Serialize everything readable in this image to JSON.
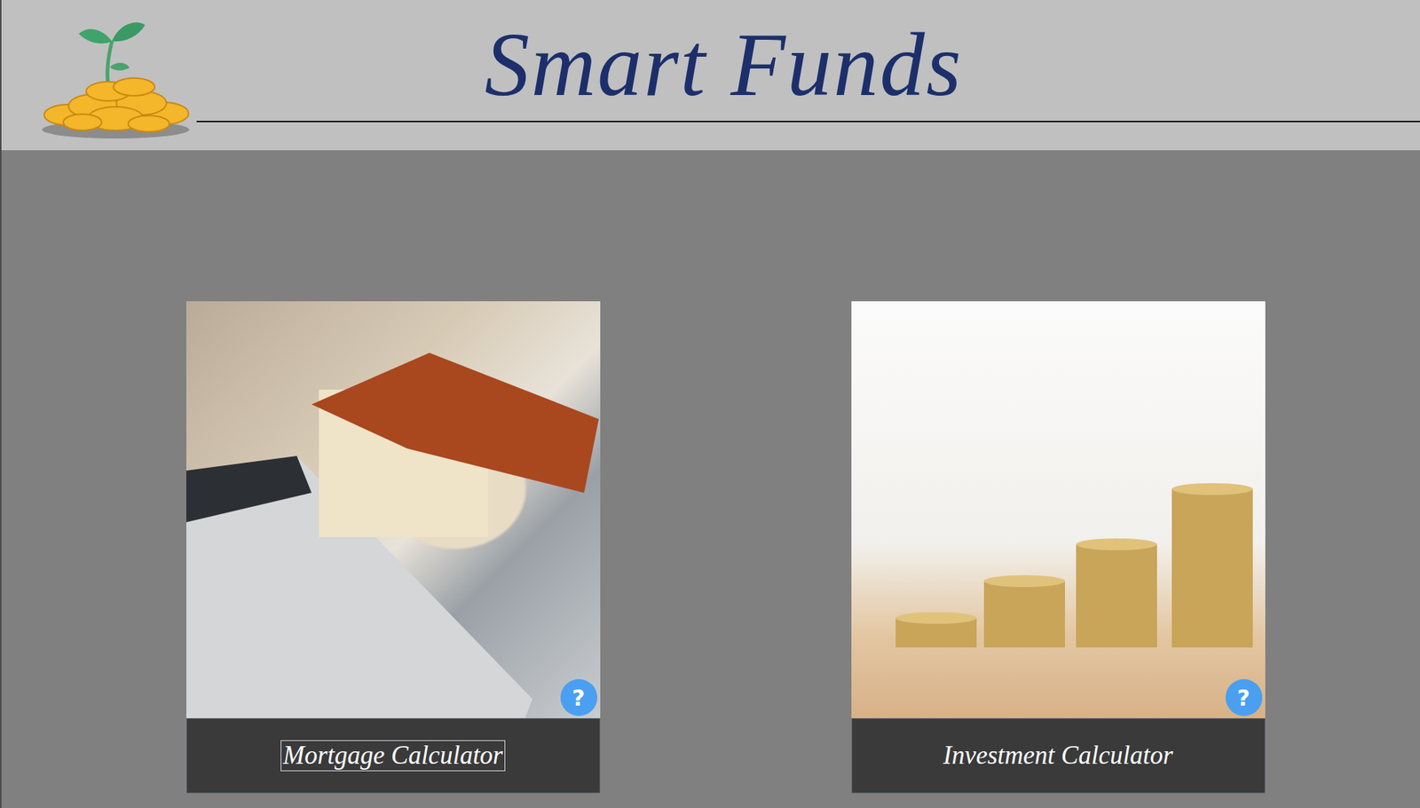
{
  "app": {
    "title": "Smart Funds"
  },
  "cards": [
    {
      "label": "Mortgage Calculator",
      "help": "?",
      "focused": true
    },
    {
      "label": "Investment Calculator",
      "help": "?",
      "focused": false
    }
  ]
}
